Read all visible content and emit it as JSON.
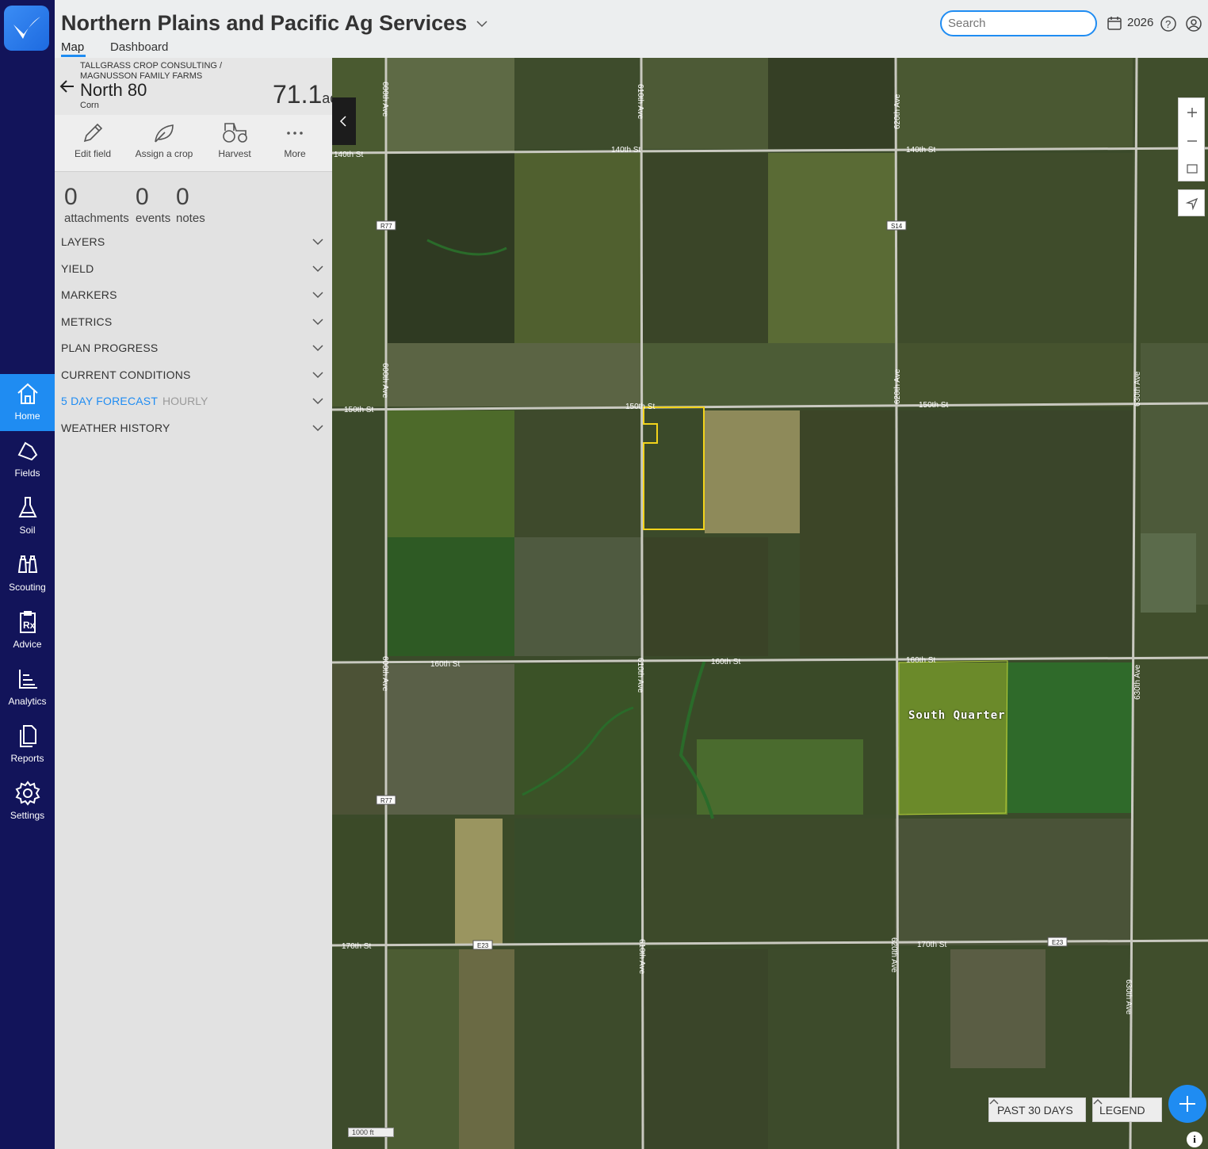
{
  "app": {
    "org_name": "Northern Plains and Pacific Ag Services",
    "tabs": [
      {
        "label": "Map"
      },
      {
        "label": "Dashboard"
      }
    ],
    "search_placeholder": "Search",
    "year": "2026"
  },
  "nav": {
    "items": [
      {
        "label": "Home",
        "icon": "home-icon",
        "active": true
      },
      {
        "label": "Fields",
        "icon": "fields-icon"
      },
      {
        "label": "Soil",
        "icon": "flask-icon"
      },
      {
        "label": "Scouting",
        "icon": "binoculars-icon"
      },
      {
        "label": "Advice",
        "icon": "prescription-icon"
      },
      {
        "label": "Analytics",
        "icon": "bar-chart-icon"
      },
      {
        "label": "Reports",
        "icon": "documents-icon"
      },
      {
        "label": "Settings",
        "icon": "gear-icon"
      }
    ]
  },
  "field": {
    "breadcrumb_line1": "TALLGRASS CROP CONSULTING /",
    "breadcrumb_line2": "MAGNUSSON FAMILY FARMS",
    "name": "North 80",
    "crop": "Corn",
    "acres": "71.1",
    "acres_unit": "ac"
  },
  "actions": [
    {
      "label": "Edit field",
      "icon": "pencil-icon"
    },
    {
      "label": "Assign a crop",
      "icon": "leaf-icon"
    },
    {
      "label": "Harvest",
      "icon": "tractor-icon"
    },
    {
      "label": "More",
      "icon": "more-icon"
    }
  ],
  "counts": [
    {
      "value": "0",
      "label": "attachments"
    },
    {
      "value": "0",
      "label": "events"
    },
    {
      "value": "0",
      "label": "notes"
    }
  ],
  "sections": [
    {
      "title": "LAYERS"
    },
    {
      "title": "YIELD"
    },
    {
      "title": "MARKERS"
    },
    {
      "title": "METRICS"
    },
    {
      "title": "PLAN PROGRESS"
    },
    {
      "title": "CURRENT CONDITIONS"
    },
    {
      "title": "5 DAY FORECAST",
      "secondary": "HOURLY"
    },
    {
      "title": "WEATHER HISTORY"
    }
  ],
  "map": {
    "field_labels": [
      "South Quarter"
    ],
    "roads_ew": [
      "140th St",
      "150th St",
      "160th St",
      "170th St"
    ],
    "roads_ns": [
      "600th Ave",
      "610th Ave",
      "620th Ave",
      "630th Ave"
    ],
    "shields": [
      "R77",
      "S14",
      "E23"
    ],
    "past_button": "PAST 30 DAYS",
    "legend_button": "LEGEND",
    "scale": "1000 ft",
    "info": "i",
    "selected_outline_color": "#f2d31b"
  }
}
